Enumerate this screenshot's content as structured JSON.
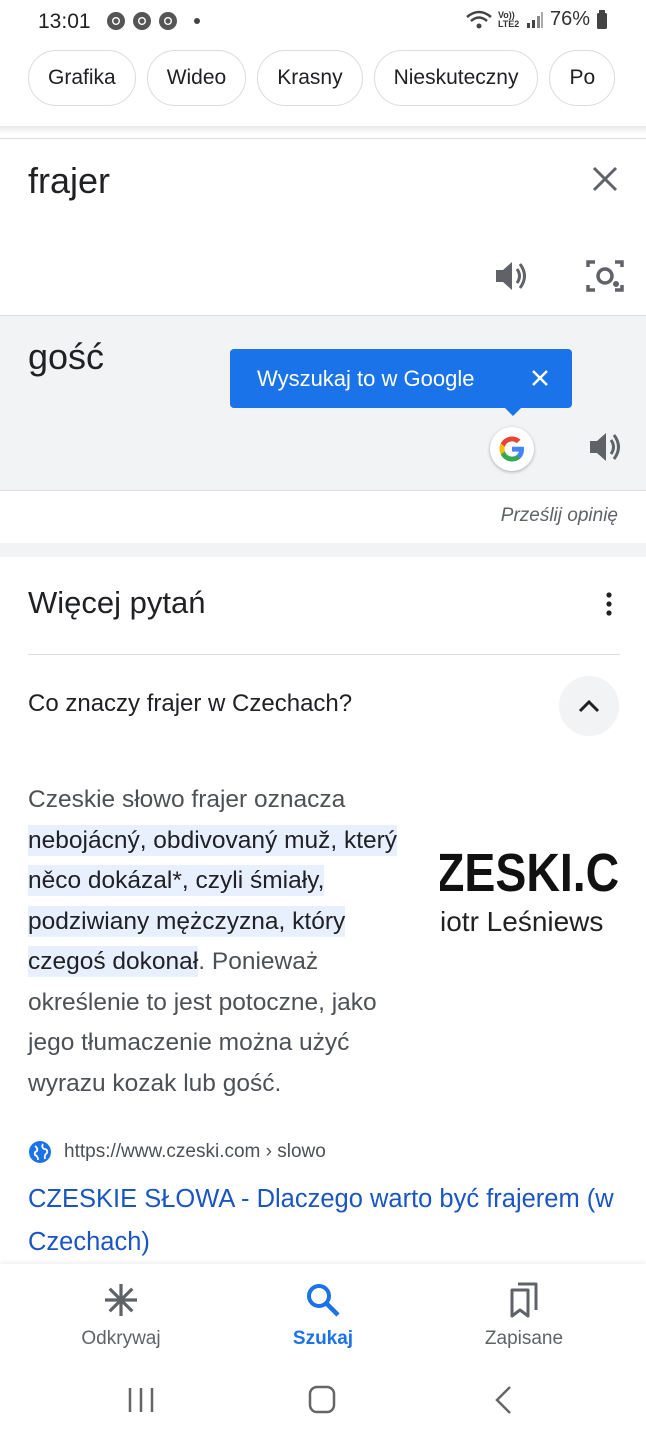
{
  "status_bar": {
    "time": "13:01",
    "battery": "76%",
    "network": "Vo)) LTE2"
  },
  "chips": [
    "Grafika",
    "Wideo",
    "Krasny",
    "Nieskuteczny",
    "Po"
  ],
  "translate": {
    "source_text": "frajer",
    "target_text": "gość",
    "tooltip": "Wyszukaj to w Google",
    "feedback": "Prześlij opinię"
  },
  "more_questions": {
    "title": "Więcej pytań",
    "question": "Co znaczy frajer w Czechach?",
    "answer": {
      "before": "Czeskie słowo frajer oznacza ",
      "highlight": "nebojácný, obdivovaný muž, který něco dokázal*, czyli śmiały, podziwiany mężczyzna, który czegoś dokonał",
      "after": ". Ponieważ określenie to jest potoczne, jako jego tłumaczenie można użyć wyrazu kozak lub gość."
    },
    "thumbnail": {
      "big_text": "ZESKI.C",
      "small_text": "iotr Leśniews"
    },
    "source_url": "https://www.czeski.com › slowo",
    "result_title": "CZESKIE SŁOWA - Dlaczego warto być frajerem (w Czechach)"
  },
  "bottom_nav": [
    {
      "label": "Odkrywaj",
      "icon": "asterisk-icon",
      "active": false
    },
    {
      "label": "Szukaj",
      "icon": "search-icon",
      "active": true
    },
    {
      "label": "Zapisane",
      "icon": "bookmarks-icon",
      "active": false
    }
  ],
  "colors": {
    "accent": "#1a73e8",
    "link": "#1a55c4",
    "highlight": "#e8f0fe",
    "panel": "#f1f3f4"
  }
}
